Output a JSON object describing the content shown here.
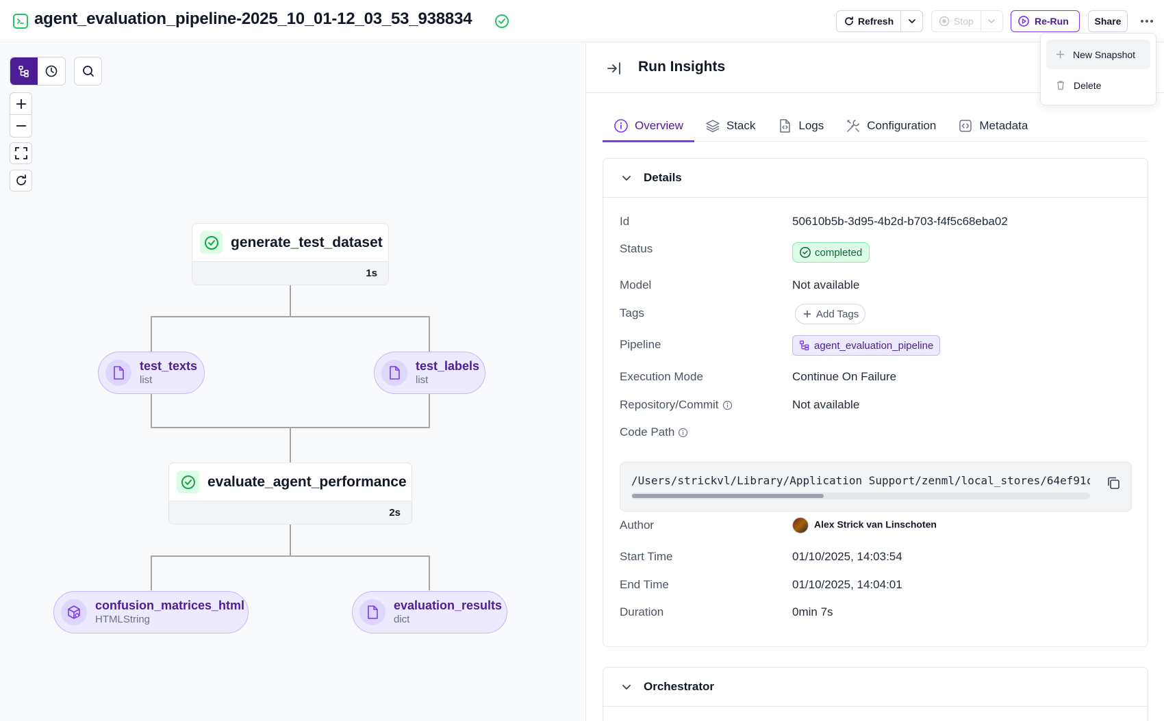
{
  "header": {
    "title": "agent_evaluation_pipeline-2025_10_01-12_03_53_938834",
    "refresh_label": "Refresh",
    "stop_label": "Stop",
    "rerun_label": "Re-Run",
    "share_label": "Share"
  },
  "dropdown": {
    "items": [
      {
        "label": "New Snapshot",
        "icon": "plus-icon"
      },
      {
        "label": "Delete",
        "icon": "trash-icon"
      }
    ]
  },
  "dag": {
    "steps": [
      {
        "name": "generate_test_dataset",
        "duration": "1s",
        "status": "completed"
      },
      {
        "name": "evaluate_agent_performance",
        "duration": "2s",
        "status": "completed"
      }
    ],
    "artifacts": [
      {
        "name": "test_texts",
        "type": "list"
      },
      {
        "name": "test_labels",
        "type": "list"
      },
      {
        "name": "confusion_matrices_html",
        "type": "HTMLString"
      },
      {
        "name": "evaluation_results",
        "type": "dict"
      }
    ]
  },
  "panel": {
    "title": "Run Insights",
    "tabs": [
      "Overview",
      "Stack",
      "Logs",
      "Configuration",
      "Metadata"
    ],
    "active_tab": "Overview",
    "details": {
      "heading": "Details",
      "id_label": "Id",
      "id": "50610b5b-3d95-4b2d-b703-f4f5c68eba02",
      "status_label": "Status",
      "status": "completed",
      "model_label": "Model",
      "model": "Not available",
      "tags_label": "Tags",
      "add_tags": "Add Tags",
      "pipeline_label": "Pipeline",
      "pipeline": "agent_evaluation_pipeline",
      "exec_mode_label": "Execution Mode",
      "exec_mode": "Continue On Failure",
      "repo_label": "Repository/Commit",
      "repo": "Not available",
      "code_path_label": "Code Path",
      "code_path": "/Users/strickvl/Library/Application Support/zenml/local_stores/64ef91c",
      "author_label": "Author",
      "author": "Alex Strick van Linschoten",
      "start_label": "Start Time",
      "start": "01/10/2025, 14:03:54",
      "end_label": "End Time",
      "end": "01/10/2025, 14:04:01",
      "duration_label": "Duration",
      "duration": "0min 7s"
    },
    "orchestrator_heading": "Orchestrator"
  },
  "colors": {
    "accent": "#4c1d95",
    "accent_light": "#ede9fe",
    "success": "#22c55e",
    "success_bg": "#dcfce7"
  }
}
